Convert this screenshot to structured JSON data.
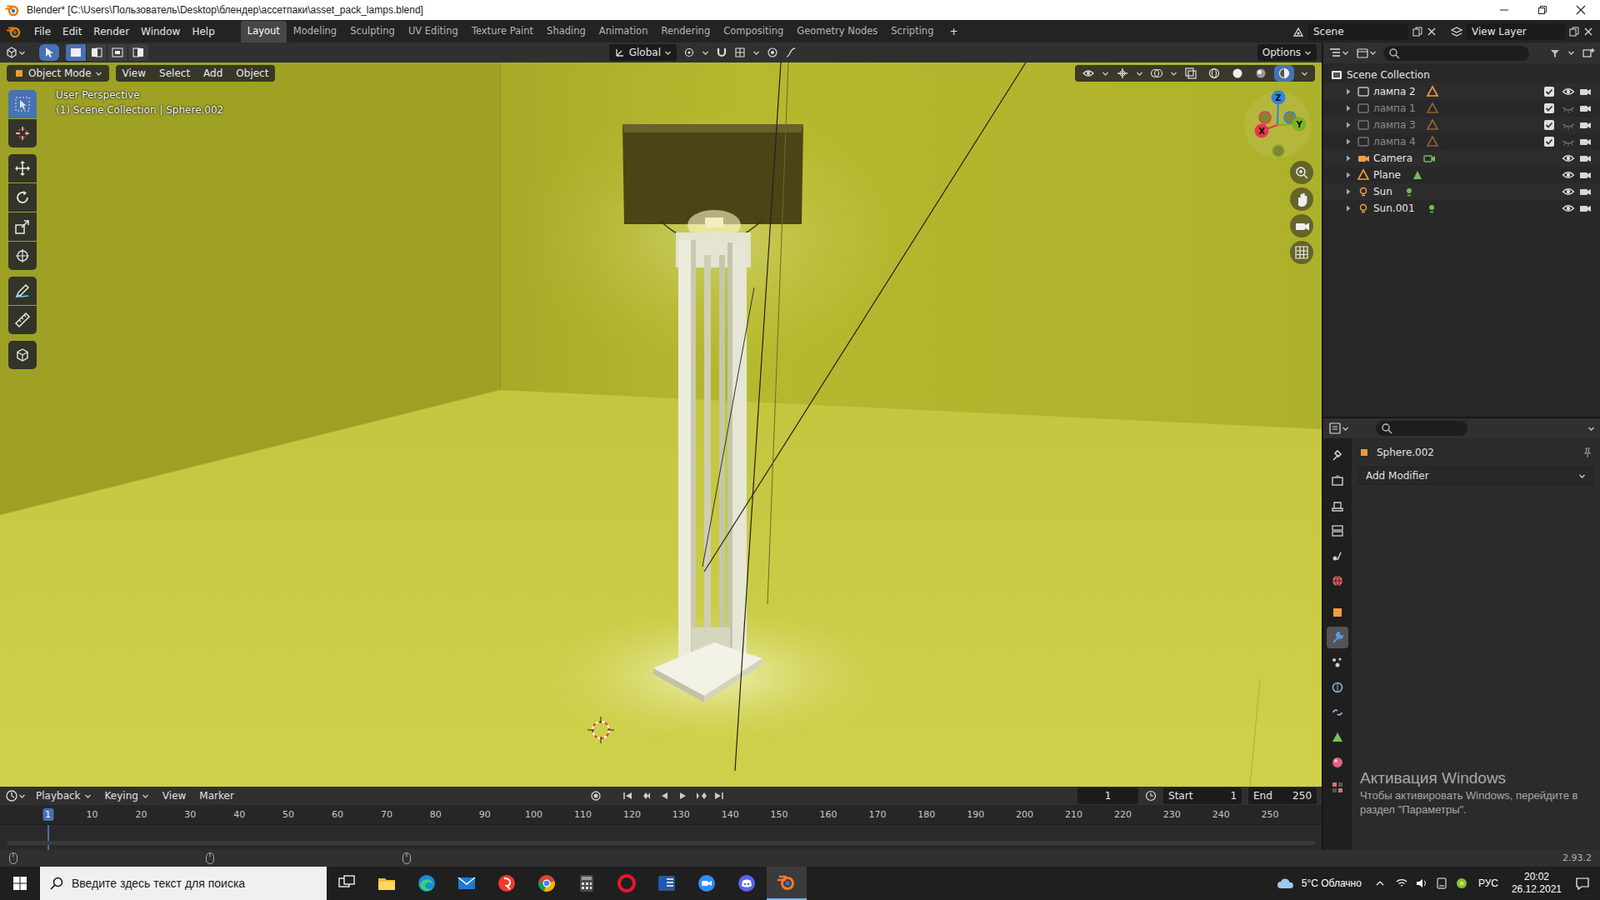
{
  "window": {
    "title": "Blender* [C:\\Users\\Пользователь\\Desktop\\блендер\\ассетпаки\\asset_pack_lamps.blend]"
  },
  "topbar": {
    "menus": [
      "File",
      "Edit",
      "Render",
      "Window",
      "Help"
    ],
    "workspaces": [
      {
        "label": "Layout",
        "selected": true
      },
      {
        "label": "Modeling",
        "selected": false
      },
      {
        "label": "Sculpting",
        "selected": false
      },
      {
        "label": "UV Editing",
        "selected": false
      },
      {
        "label": "Texture Paint",
        "selected": false
      },
      {
        "label": "Shading",
        "selected": false
      },
      {
        "label": "Animation",
        "selected": false
      },
      {
        "label": "Rendering",
        "selected": false
      },
      {
        "label": "Compositing",
        "selected": false
      },
      {
        "label": "Geometry Nodes",
        "selected": false
      },
      {
        "label": "Scripting",
        "selected": false
      }
    ],
    "add_workspace": "+",
    "scene": "Scene",
    "view_layer": "View Layer"
  },
  "viewport": {
    "select_modes": [
      {
        "selected": true
      },
      {
        "selected": false
      },
      {
        "selected": false
      },
      {
        "selected": false
      }
    ],
    "orientation": "Global",
    "options": "Options",
    "mode": "Object Mode",
    "menus": [
      "View",
      "Select",
      "Add",
      "Object"
    ],
    "shading": [
      {
        "selected": false
      },
      {
        "selected": false
      },
      {
        "selected": false
      },
      {
        "selected": true
      }
    ],
    "info": [
      "User Perspective",
      "(1) Scene Collection | Sphere.002"
    ],
    "tools": [
      {
        "selected": true
      },
      {
        "selected": false
      },
      {
        "selected": false
      },
      {
        "selected": false
      },
      {
        "selected": false
      },
      {
        "selected": false
      },
      {
        "selected": false
      },
      {
        "selected": false
      },
      {
        "selected": false
      }
    ],
    "gizmo": [
      {
        "label": "Z",
        "color": "#2f83e8"
      },
      {
        "label": "Y",
        "color": "#7bb31f"
      },
      {
        "label": "X",
        "color": "#e8364f"
      }
    ]
  },
  "outliner": {
    "root": "Scene Collection",
    "items": [
      {
        "label": "лампа 2",
        "kind": "collection",
        "checked": true,
        "visible": true
      },
      {
        "label": "лампа 1",
        "kind": "collection",
        "checked": true,
        "visible": false
      },
      {
        "label": "лампа 3",
        "kind": "collection",
        "checked": true,
        "visible": false
      },
      {
        "label": "лампа 4",
        "kind": "collection",
        "checked": true,
        "visible": false
      },
      {
        "label": "Camera",
        "kind": "camera",
        "visible": true
      },
      {
        "label": "Plane",
        "kind": "mesh",
        "visible": true
      },
      {
        "label": "Sun",
        "kind": "light",
        "visible": true
      },
      {
        "label": "Sun.001",
        "kind": "light",
        "visible": true
      }
    ]
  },
  "properties": {
    "tabs": [
      {
        "selected": false
      },
      {
        "selected": false
      },
      {
        "selected": false
      },
      {
        "selected": false
      },
      {
        "selected": false
      },
      {
        "selected": false
      },
      {
        "selected": false
      },
      {
        "selected": true
      },
      {
        "selected": false
      },
      {
        "selected": false
      },
      {
        "selected": false
      },
      {
        "selected": false
      },
      {
        "selected": false
      },
      {
        "selected": false
      }
    ],
    "object": "Sphere.002",
    "add_modifier": "Add Modifier"
  },
  "timeline": {
    "menus": [
      "Playback",
      "Keying",
      "View",
      "Marker"
    ],
    "frame": "1",
    "start_label": "Start",
    "start": "1",
    "end_label": "End",
    "end": "250",
    "ticks": [
      "1",
      "10",
      "20",
      "30",
      "40",
      "50",
      "60",
      "70",
      "80",
      "90",
      "100",
      "110",
      "120",
      "130",
      "140",
      "150",
      "160",
      "170",
      "180",
      "190",
      "200",
      "210",
      "220",
      "230",
      "240",
      "250"
    ]
  },
  "status_bar": {
    "version": "2.93.2"
  },
  "watermark": {
    "title": "Активация Windows",
    "text": "Чтобы активировать Windows, перейдите в раздел \"Параметры\"."
  },
  "taskbar": {
    "search": "Введите здесь текст для поиска",
    "apps": [
      {
        "selected": false
      },
      {
        "selected": false
      },
      {
        "selected": false
      },
      {
        "selected": false
      },
      {
        "selected": false
      },
      {
        "selected": false
      },
      {
        "selected": false
      },
      {
        "selected": false
      },
      {
        "selected": false
      },
      {
        "selected": false
      },
      {
        "selected": false
      },
      {
        "selected": true
      }
    ],
    "weather": "5°C Облачно",
    "language": "РУС",
    "time": "20:02",
    "date": "26.12.2021"
  }
}
